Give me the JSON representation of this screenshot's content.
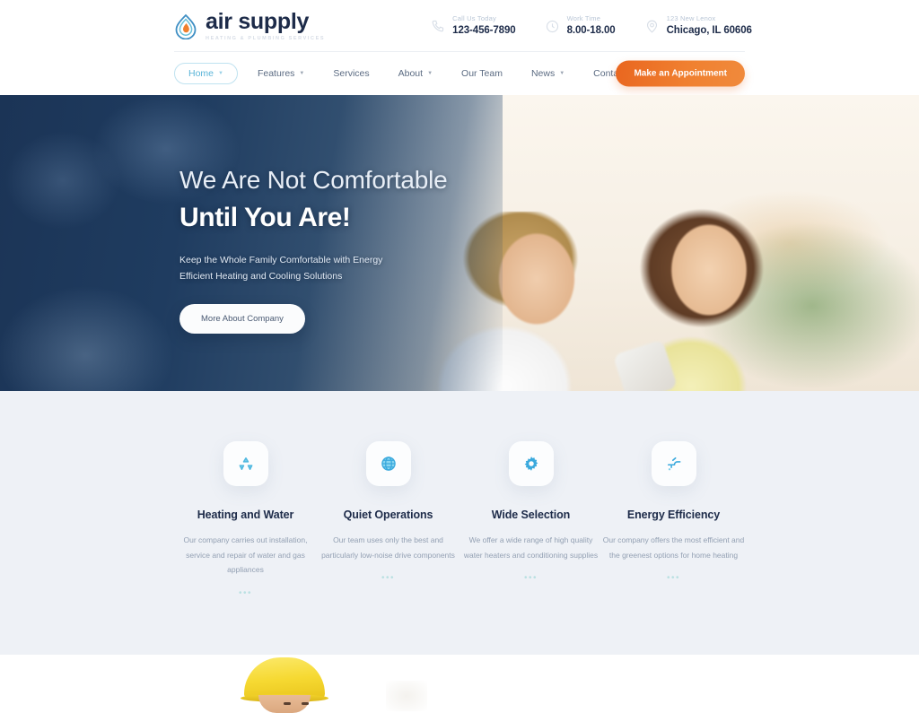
{
  "brand": {
    "name": "air supply",
    "tagline": "HEATING & PLUMBING SERVICES",
    "logo_icon": "water-drop-flame-icon",
    "accent_orange": "#ef7f2e",
    "accent_blue": "#5ab4d8",
    "dark_navy": "#1d2b49"
  },
  "header": {
    "contacts": [
      {
        "icon": "phone-icon",
        "label": "Call Us Today",
        "value": "123-456-7890"
      },
      {
        "icon": "clock-icon",
        "label": "Work Time",
        "value": "8.00-18.00"
      },
      {
        "icon": "map-pin-icon",
        "label": "123 New Lenox",
        "value": "Chicago, IL 60606"
      }
    ],
    "nav": [
      {
        "label": "Home",
        "active": true,
        "has_dropdown": true
      },
      {
        "label": "Features",
        "active": false,
        "has_dropdown": true
      },
      {
        "label": "Services",
        "active": false,
        "has_dropdown": false
      },
      {
        "label": "About",
        "active": false,
        "has_dropdown": true
      },
      {
        "label": "Our Team",
        "active": false,
        "has_dropdown": false
      },
      {
        "label": "News",
        "active": false,
        "has_dropdown": true
      },
      {
        "label": "Contacts",
        "active": false,
        "has_dropdown": false
      }
    ],
    "cta_button": "Make an Appointment"
  },
  "hero": {
    "line1": "We Are Not Comfortable",
    "line2": "Until You Are!",
    "subtitle": "Keep the Whole Family Comfortable with Energy Efficient Heating and Cooling Solutions",
    "button": "More About Company"
  },
  "features": [
    {
      "icon": "recycle-icon",
      "title": "Heating and Water",
      "desc": "Our company carries out installation, service and repair of water and gas appliances",
      "dots": "•••"
    },
    {
      "icon": "globe-icon",
      "title": "Quiet Operations",
      "desc": "Our team uses only the best and particularly low-noise drive components",
      "dots": "•••"
    },
    {
      "icon": "gear-icon",
      "title": "Wide Selection",
      "desc": "We offer a wide range of high quality water heaters and conditioning supplies",
      "dots": "•••"
    },
    {
      "icon": "faucet-icon",
      "title": "Energy Efficiency",
      "desc": "Our company offers the most efficient and the greenest options for home heating",
      "dots": "•••"
    }
  ]
}
